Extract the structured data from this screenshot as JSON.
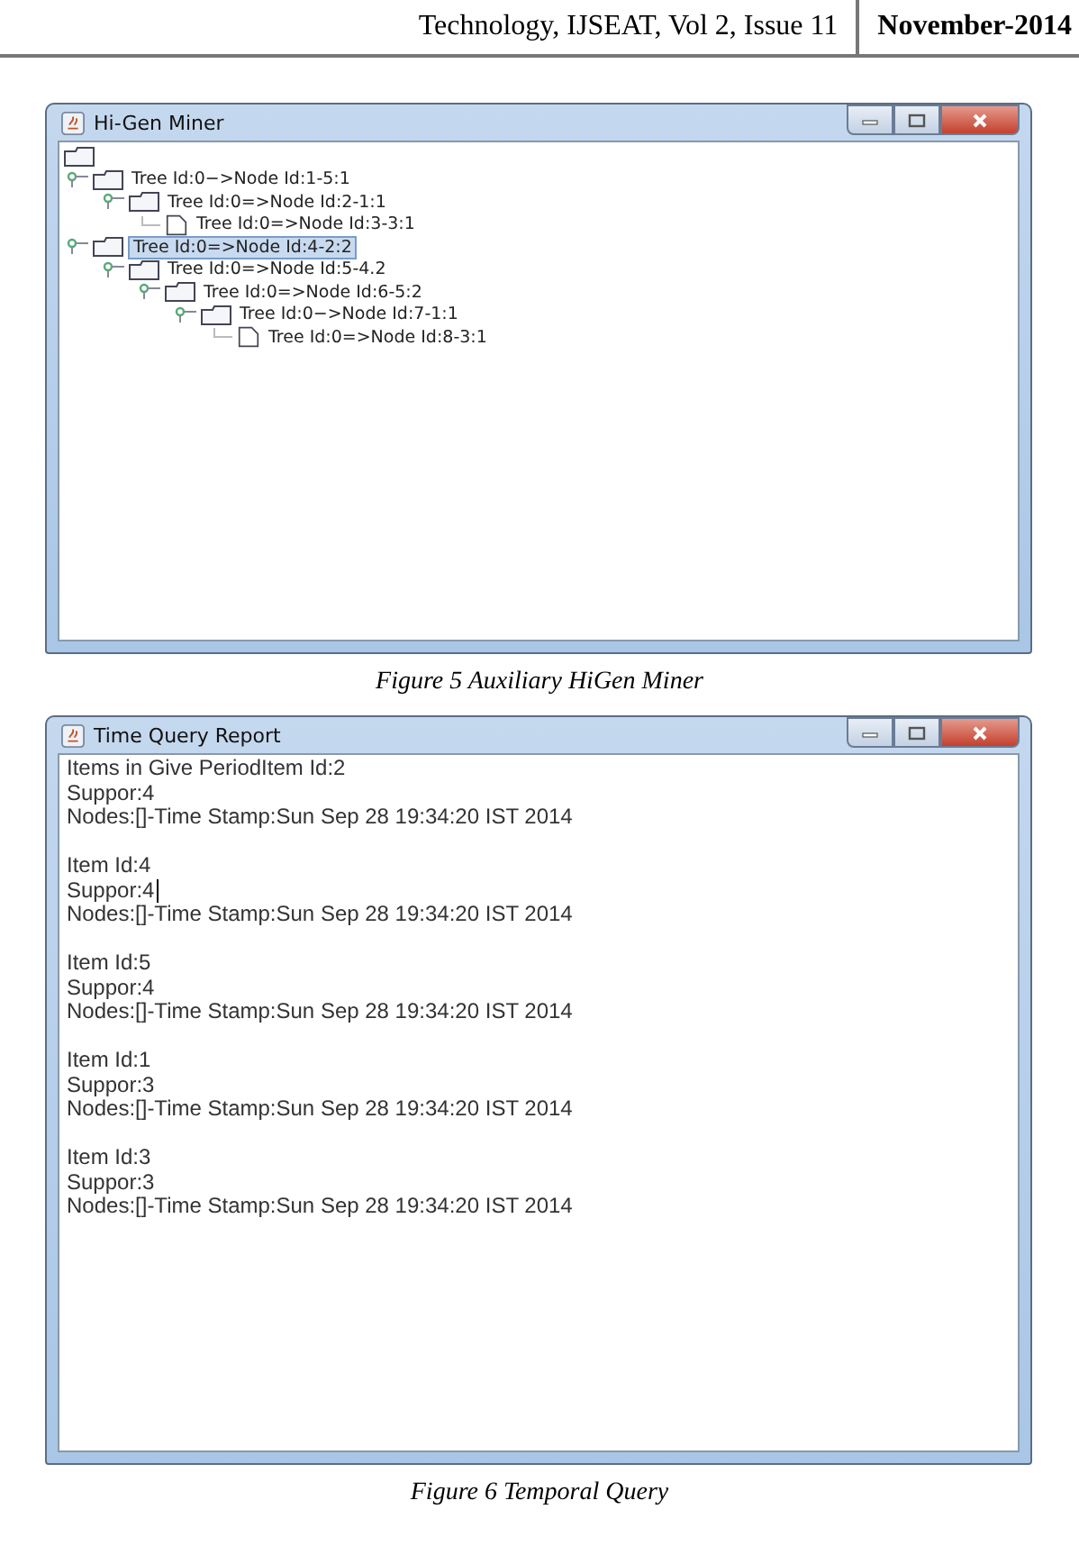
{
  "header": {
    "journal": "Technology, IJSEAT,  Vol 2, Issue 11",
    "date": "November-2014"
  },
  "figures": [
    {
      "window": {
        "title": "Hi-Gen Miner"
      },
      "kind": "tree",
      "tree": [
        {
          "kind": "folder",
          "expanded": true,
          "selected": false,
          "children": [
            {
              "label": "Tree Id:0−>Node Id:1-5:1",
              "kind": "folder",
              "expanded": true,
              "selected": false,
              "children": [
                {
                  "label": "Tree Id:0=>Node Id:2-1:1",
                  "kind": "folder",
                  "expanded": true,
                  "selected": false,
                  "children": [
                    {
                      "label": "Tree Id:0=>Node Id:3-3:1",
                      "kind": "leaf",
                      "selected": false
                    }
                  ]
                }
              ]
            },
            {
              "label": "Tree Id:0=>Node Id:4-2:2",
              "kind": "folder",
              "expanded": true,
              "selected": true,
              "children": [
                {
                  "label": "Tree Id:0=>Node Id:5-4.2",
                  "kind": "folder",
                  "expanded": true,
                  "selected": false,
                  "children": [
                    {
                      "label": "Tree Id:0=>Node Id:6-5:2",
                      "kind": "folder",
                      "expanded": true,
                      "selected": false,
                      "children": [
                        {
                          "label": "Tree Id:0−>Node Id:7-1:1",
                          "kind": "folder",
                          "expanded": true,
                          "selected": false,
                          "children": [
                            {
                              "label": "Tree Id:0=>Node Id:8-3:1",
                              "kind": "leaf",
                              "selected": false
                            }
                          ]
                        }
                      ]
                    }
                  ]
                }
              ]
            }
          ]
        }
      ],
      "caption": "Figure 5 Auxiliary HiGen Miner"
    },
    {
      "window": {
        "title": "Time Query Report"
      },
      "kind": "text",
      "blocks": [
        [
          {
            "text": "Items in Give PeriodItem Id:2",
            "cursor": false
          },
          {
            "text": "Suppor:4",
            "cursor": false
          },
          {
            "text": "Nodes:[]-Time Stamp:Sun Sep 28 19:34:20 IST 2014",
            "cursor": false
          }
        ],
        [
          {
            "text": "Item Id:4",
            "cursor": false
          },
          {
            "text": "Suppor:4",
            "cursor": true
          },
          {
            "text": "Nodes:[]-Time Stamp:Sun Sep 28 19:34:20 IST 2014",
            "cursor": false
          }
        ],
        [
          {
            "text": "Item Id:5",
            "cursor": false
          },
          {
            "text": "Suppor:4",
            "cursor": false
          },
          {
            "text": "Nodes:[]-Time Stamp:Sun Sep 28 19:34:20 IST 2014",
            "cursor": false
          }
        ],
        [
          {
            "text": "Item Id:1",
            "cursor": false
          },
          {
            "text": "Suppor:3",
            "cursor": false
          },
          {
            "text": "Nodes:[]-Time Stamp:Sun Sep 28 19:34:20 IST 2014",
            "cursor": false
          }
        ],
        [
          {
            "text": "Item Id:3",
            "cursor": false
          },
          {
            "text": "Suppor:3",
            "cursor": false
          },
          {
            "text": "Nodes:[]-Time Stamp:Sun Sep 28 19:34:20 IST 2014",
            "cursor": false
          }
        ]
      ],
      "caption": "Figure 6 Temporal Query"
    }
  ]
}
